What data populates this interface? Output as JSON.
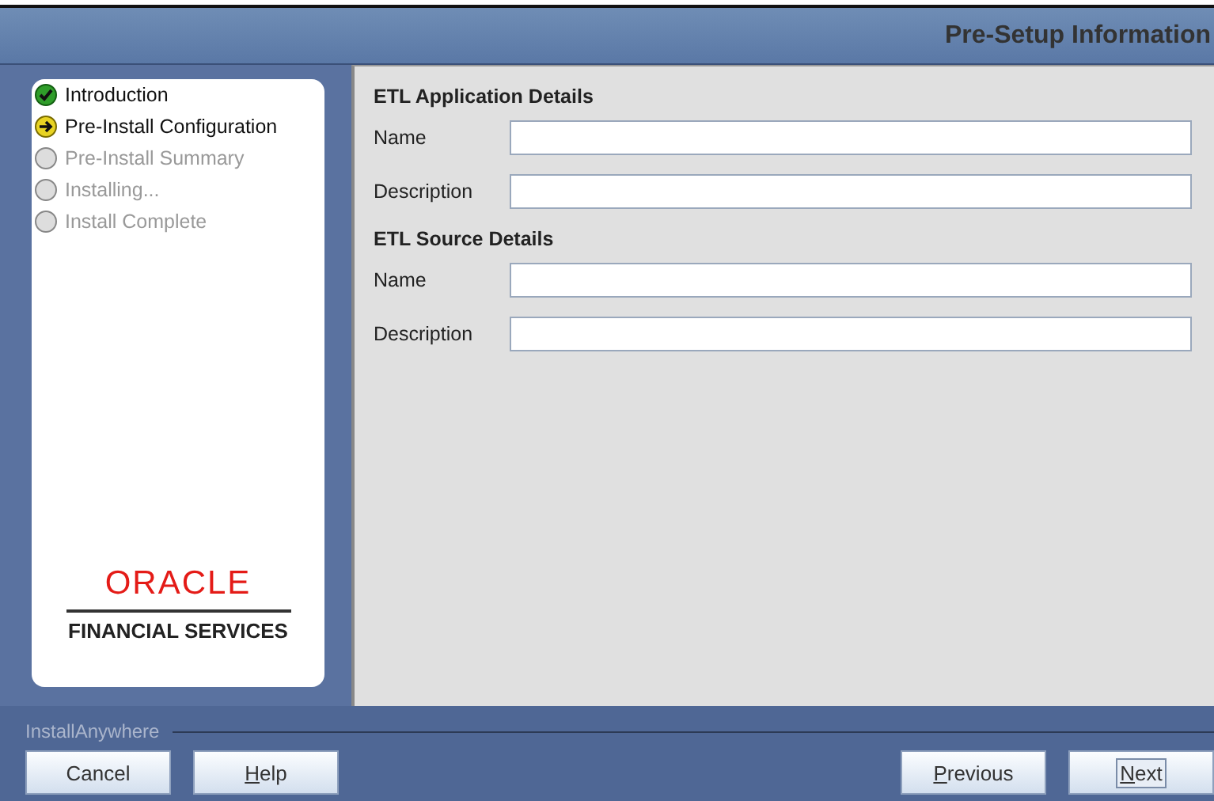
{
  "header": {
    "title": "Pre-Setup Information"
  },
  "steps": [
    {
      "label": "Introduction",
      "kind": "done"
    },
    {
      "label": "Pre-Install Configuration",
      "kind": "current"
    },
    {
      "label": "Pre-Install Summary",
      "kind": "pending"
    },
    {
      "label": "Installing...",
      "kind": "pending"
    },
    {
      "label": "Install Complete",
      "kind": "pending"
    }
  ],
  "logo": {
    "brand": "ORACLE",
    "subtitle": "FINANCIAL SERVICES"
  },
  "sections": [
    {
      "title": "ETL Application Details",
      "fields": [
        {
          "label": "Name"
        },
        {
          "label": "Description"
        }
      ]
    },
    {
      "title": "ETL Source Details",
      "fields": [
        {
          "label": "Name"
        },
        {
          "label": "Description"
        }
      ]
    }
  ],
  "footer": {
    "vendor": "InstallAnywhere"
  },
  "buttons_left": [
    {
      "label": "Cancel",
      "underline_first": false
    },
    {
      "label": "Help",
      "underline_first": true
    }
  ],
  "buttons_right": [
    {
      "label": "Previous",
      "underline_first": true,
      "focused": false
    },
    {
      "label": "Next",
      "underline_first": true,
      "focused": true
    }
  ]
}
